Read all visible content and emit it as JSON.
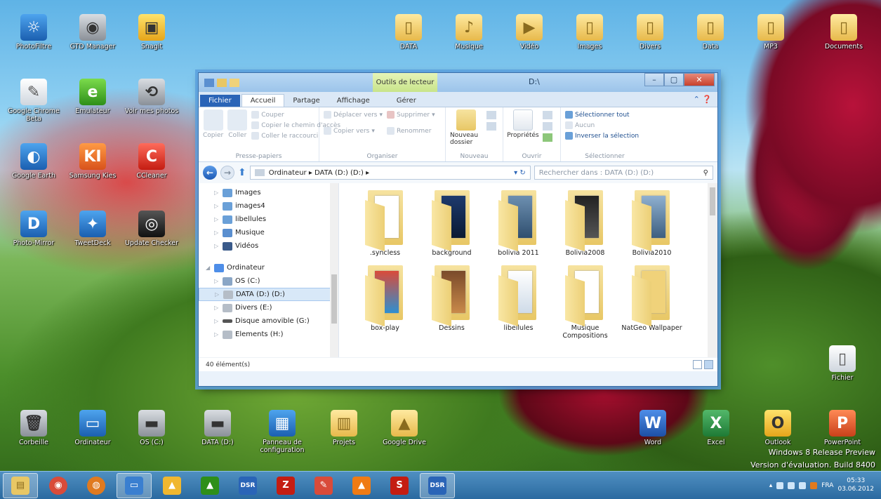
{
  "desktop_icons": [
    {
      "label": "PhotoFiltre",
      "glyph": "☼"
    },
    {
      "label": "GTD Manager",
      "glyph": "◉"
    },
    {
      "label": "Snagit",
      "glyph": "▣"
    },
    {
      "label": "Google Chrome Beta",
      "glyph": "✎"
    },
    {
      "label": "Emulateur",
      "glyph": "e"
    },
    {
      "label": "Voir mes photos",
      "glyph": "⟲"
    },
    {
      "label": "Google Earth",
      "glyph": "◐"
    },
    {
      "label": "Samsung Kies",
      "glyph": "KI"
    },
    {
      "label": "CCleaner",
      "glyph": "C"
    },
    {
      "label": "Photo-Mirror",
      "glyph": "D"
    },
    {
      "label": "TweetDeck",
      "glyph": "✦"
    },
    {
      "label": "Update Checker",
      "glyph": "◎"
    }
  ],
  "top_folders": [
    "DATA",
    "Musique",
    "Vidéo",
    "Images",
    "Divers",
    "Data",
    "MP3",
    "Documents"
  ],
  "bottom_icons": [
    {
      "label": "Corbeille",
      "glyph": "🗑"
    },
    {
      "label": "Ordinateur",
      "glyph": "▭"
    },
    {
      "label": "OS (C:)",
      "glyph": "▬"
    },
    {
      "label": "DATA (D:)",
      "glyph": "▬"
    },
    {
      "label": "Panneau de configuration",
      "glyph": "▦"
    },
    {
      "label": "Projets",
      "glyph": "▥"
    },
    {
      "label": "Google Drive",
      "glyph": "▲"
    },
    {
      "label": "Word",
      "glyph": "W"
    },
    {
      "label": "Excel",
      "glyph": "X"
    },
    {
      "label": "Outlook",
      "glyph": "O"
    },
    {
      "label": "PowerPoint",
      "glyph": "P"
    },
    {
      "label": "Fichier",
      "glyph": "▯"
    }
  ],
  "explorer": {
    "contextual_tab": "Outils de lecteur",
    "title": "D:\\",
    "controls": {
      "minimize": "–",
      "maximize": "▢",
      "close": "✕"
    },
    "tabs": [
      "Fichier",
      "Accueil",
      "Partage",
      "Affichage",
      "Gérer"
    ],
    "ribbon": {
      "clipboard": {
        "copy": "Copier",
        "paste": "Coller",
        "cut": "Couper",
        "copy_path": "Copier le chemin d'accès",
        "paste_shortcut": "Coller le raccourci",
        "label": "Presse-papiers"
      },
      "organize": {
        "move_to": "Déplacer vers",
        "copy_to": "Copier vers",
        "delete": "Supprimer",
        "rename": "Renommer",
        "label": "Organiser"
      },
      "new": {
        "new_folder": "Nouveau dossier",
        "label": "Nouveau"
      },
      "open": {
        "properties": "Propriétés",
        "label": "Ouvrir"
      },
      "select": {
        "select_all": "Sélectionner tout",
        "none": "Aucun",
        "invert": "Inverser la sélection",
        "label": "Sélectionner"
      }
    },
    "address": {
      "path": "Ordinateur ▸ DATA (D:) (D:) ▸",
      "search_placeholder": "Rechercher dans : DATA (D:) (D:)"
    },
    "nav_items": [
      {
        "label": "Images",
        "color": "#6aa0d8"
      },
      {
        "label": "images4",
        "color": "#6aa0d8"
      },
      {
        "label": "libellules",
        "color": "#6aa0d8"
      },
      {
        "label": "Musique",
        "color": "#5a8fd0"
      },
      {
        "label": "Vidéos",
        "color": "#3a5a8a"
      }
    ],
    "nav_computer": "Ordinateur",
    "drives": [
      {
        "label": "OS (C:)",
        "selected": false
      },
      {
        "label": "DATA (D:) (D:)",
        "selected": true
      },
      {
        "label": "Divers (E:)",
        "selected": false
      },
      {
        "label": "Disque amovible (G:)",
        "selected": false
      },
      {
        "label": "Elements (H:)",
        "selected": false
      }
    ],
    "files": [
      ".syncless",
      "background",
      "bolivia 2011",
      "Bolivia2008",
      "Bolivia2010",
      "box-play",
      "Dessins",
      "libellules",
      "Musique Compositions",
      "NatGeo Wallpaper"
    ],
    "status": "40 élément(s)"
  },
  "watermark": {
    "line1": "Windows 8 Release Preview",
    "line2": "Version d'évaluation. Build 8400"
  },
  "taskbar": {
    "apps": [
      {
        "name": "explorer",
        "glyph": "▤",
        "color": "#e8c765"
      },
      {
        "name": "chrome",
        "glyph": "◉",
        "color": "#d94b3a"
      },
      {
        "name": "firefox",
        "glyph": "◍",
        "color": "#e07a1f"
      },
      {
        "name": "desktop",
        "glyph": "▭",
        "color": "#3a7fd0"
      },
      {
        "name": "drive",
        "glyph": "▲",
        "color": "#f0b72f"
      },
      {
        "name": "google-earth",
        "glyph": "▲",
        "color": "#2e8f19"
      },
      {
        "name": "dsr-1",
        "glyph": "DSR",
        "color": "#2a64b7"
      },
      {
        "name": "filezilla",
        "glyph": "Z",
        "color": "#c41d12"
      },
      {
        "name": "editor",
        "glyph": "✎",
        "color": "#d94b3a"
      },
      {
        "name": "vlc",
        "glyph": "▲",
        "color": "#ef7b14"
      },
      {
        "name": "skype",
        "glyph": "S",
        "color": "#c41d12"
      },
      {
        "name": "dsr-2",
        "glyph": "DSR",
        "color": "#2a64b7"
      }
    ],
    "language": "FRA",
    "time": "05:33",
    "date": "03.06.2012"
  }
}
